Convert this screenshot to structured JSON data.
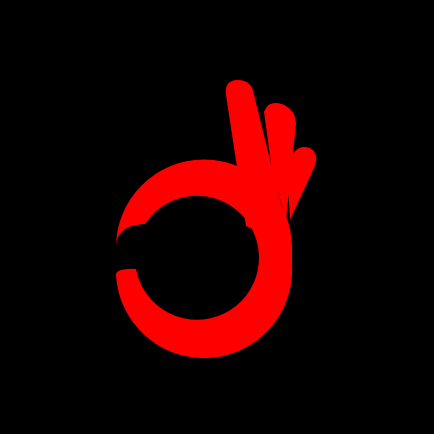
{
  "app_icon": {
    "icon": "ok-hand-icon",
    "colors": {
      "background": "#000000",
      "foreground": "#ff0000"
    }
  }
}
